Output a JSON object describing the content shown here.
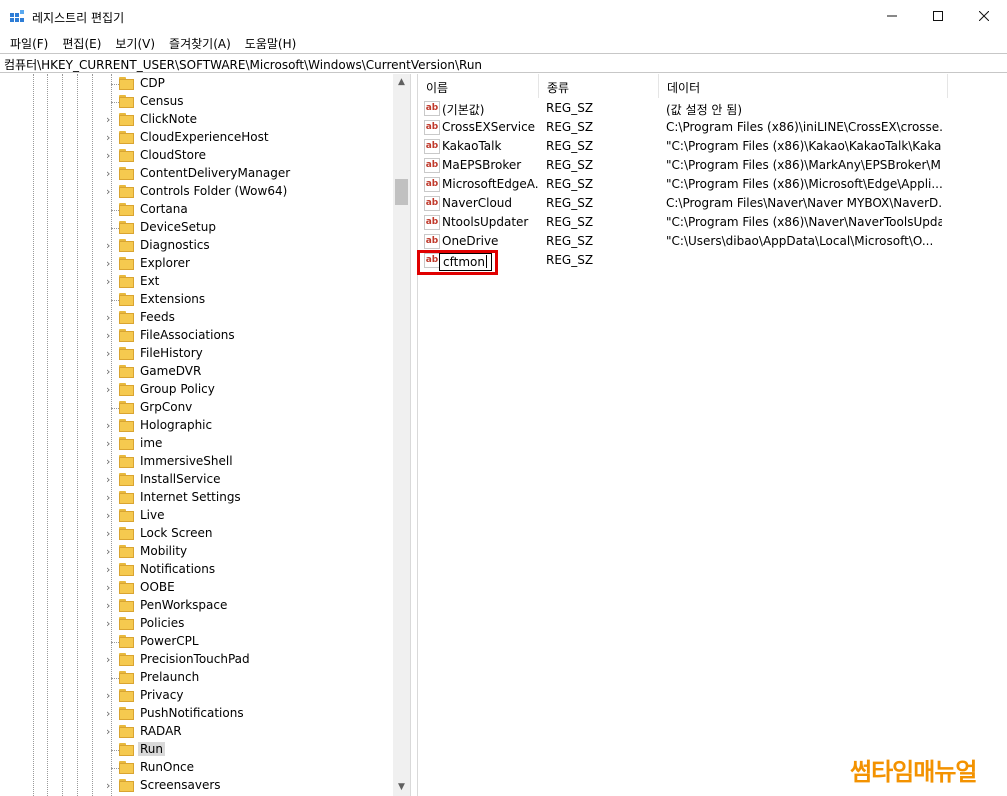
{
  "window": {
    "title": "레지스트리 편집기",
    "minimize_icon": "minimize-icon",
    "maximize_icon": "maximize-icon",
    "close_icon": "close-icon"
  },
  "menu": [
    "파일(F)",
    "편집(E)",
    "보기(V)",
    "즐겨찾기(A)",
    "도움말(H)"
  ],
  "address": "컴퓨터\\HKEY_CURRENT_USER\\SOFTWARE\\Microsoft\\Windows\\CurrentVersion\\Run",
  "tree": {
    "selected": "Run",
    "items": [
      {
        "label": "CDP",
        "expandable": false
      },
      {
        "label": "Census",
        "expandable": false
      },
      {
        "label": "ClickNote",
        "expandable": true
      },
      {
        "label": "CloudExperienceHost",
        "expandable": true
      },
      {
        "label": "CloudStore",
        "expandable": true
      },
      {
        "label": "ContentDeliveryManager",
        "expandable": true
      },
      {
        "label": "Controls Folder (Wow64)",
        "expandable": true
      },
      {
        "label": "Cortana",
        "expandable": false
      },
      {
        "label": "DeviceSetup",
        "expandable": false
      },
      {
        "label": "Diagnostics",
        "expandable": true
      },
      {
        "label": "Explorer",
        "expandable": true
      },
      {
        "label": "Ext",
        "expandable": true
      },
      {
        "label": "Extensions",
        "expandable": false
      },
      {
        "label": "Feeds",
        "expandable": true
      },
      {
        "label": "FileAssociations",
        "expandable": true
      },
      {
        "label": "FileHistory",
        "expandable": true
      },
      {
        "label": "GameDVR",
        "expandable": true
      },
      {
        "label": "Group Policy",
        "expandable": true
      },
      {
        "label": "GrpConv",
        "expandable": false
      },
      {
        "label": "Holographic",
        "expandable": true
      },
      {
        "label": "ime",
        "expandable": true
      },
      {
        "label": "ImmersiveShell",
        "expandable": true
      },
      {
        "label": "InstallService",
        "expandable": true
      },
      {
        "label": "Internet Settings",
        "expandable": true
      },
      {
        "label": "Live",
        "expandable": true
      },
      {
        "label": "Lock Screen",
        "expandable": true
      },
      {
        "label": "Mobility",
        "expandable": true
      },
      {
        "label": "Notifications",
        "expandable": true
      },
      {
        "label": "OOBE",
        "expandable": true
      },
      {
        "label": "PenWorkspace",
        "expandable": true
      },
      {
        "label": "Policies",
        "expandable": true
      },
      {
        "label": "PowerCPL",
        "expandable": false
      },
      {
        "label": "PrecisionTouchPad",
        "expandable": true
      },
      {
        "label": "Prelaunch",
        "expandable": false
      },
      {
        "label": "Privacy",
        "expandable": true
      },
      {
        "label": "PushNotifications",
        "expandable": true
      },
      {
        "label": "RADAR",
        "expandable": true
      },
      {
        "label": "Run",
        "expandable": false
      },
      {
        "label": "RunOnce",
        "expandable": false
      },
      {
        "label": "Screensavers",
        "expandable": true
      }
    ]
  },
  "list": {
    "columns": [
      "이름",
      "종류",
      "데이터"
    ],
    "rows": [
      {
        "name": "(기본값)",
        "type": "REG_SZ",
        "data": "(값 설정 안 됨)"
      },
      {
        "name": "CrossEXService",
        "type": "REG_SZ",
        "data": "C:\\Program Files (x86)\\iniLINE\\CrossEX\\crosse..."
      },
      {
        "name": "KakaoTalk",
        "type": "REG_SZ",
        "data": "\"C:\\Program Files (x86)\\Kakao\\KakaoTalk\\Kaka..."
      },
      {
        "name": "MaEPSBroker",
        "type": "REG_SZ",
        "data": "\"C:\\Program Files (x86)\\MarkAny\\EPSBroker\\M..."
      },
      {
        "name": "MicrosoftEdgeA...",
        "type": "REG_SZ",
        "data": "\"C:\\Program Files (x86)\\Microsoft\\Edge\\Appli..."
      },
      {
        "name": "NaverCloud",
        "type": "REG_SZ",
        "data": "C:\\Program Files\\Naver\\Naver MYBOX\\NaverD..."
      },
      {
        "name": "NtoolsUpdater",
        "type": "REG_SZ",
        "data": "\"C:\\Program Files (x86)\\Naver\\NaverToolsUpda..."
      },
      {
        "name": "OneDrive",
        "type": "REG_SZ",
        "data": "\"C:\\Users\\dibao\\AppData\\Local\\Microsoft\\O..."
      }
    ],
    "editing_row": {
      "name": "cftmon",
      "type": "REG_SZ"
    }
  },
  "watermark": "썸타임매뉴얼",
  "colors": {
    "highlight": "#e00000",
    "watermark": "#f39200"
  }
}
